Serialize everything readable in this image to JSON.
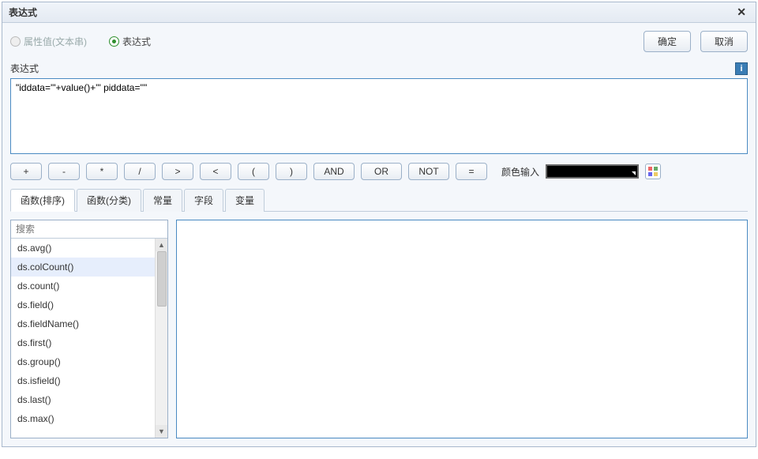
{
  "title": "表达式",
  "radios": {
    "attr": "属性值(文本串)",
    "expr": "表达式"
  },
  "buttons": {
    "ok": "确定",
    "cancel": "取消"
  },
  "section_label": "表达式",
  "expression_value": "\"iddata='\"+value()+\"' piddata=''\"",
  "ops": [
    "+",
    "-",
    "*",
    "/",
    ">",
    "<",
    "(",
    ")",
    "AND",
    "OR",
    "NOT",
    "="
  ],
  "color_label": "颜色输入",
  "tabs": [
    "函数(排序)",
    "函数(分类)",
    "常量",
    "字段",
    "变量"
  ],
  "search_placeholder": "搜索",
  "functions": [
    "ds.avg()",
    "ds.colCount()",
    "ds.count()",
    "ds.field()",
    "ds.fieldName()",
    "ds.first()",
    "ds.group()",
    "ds.isfield()",
    "ds.last()",
    "ds.max()"
  ],
  "selected_function_index": 1
}
